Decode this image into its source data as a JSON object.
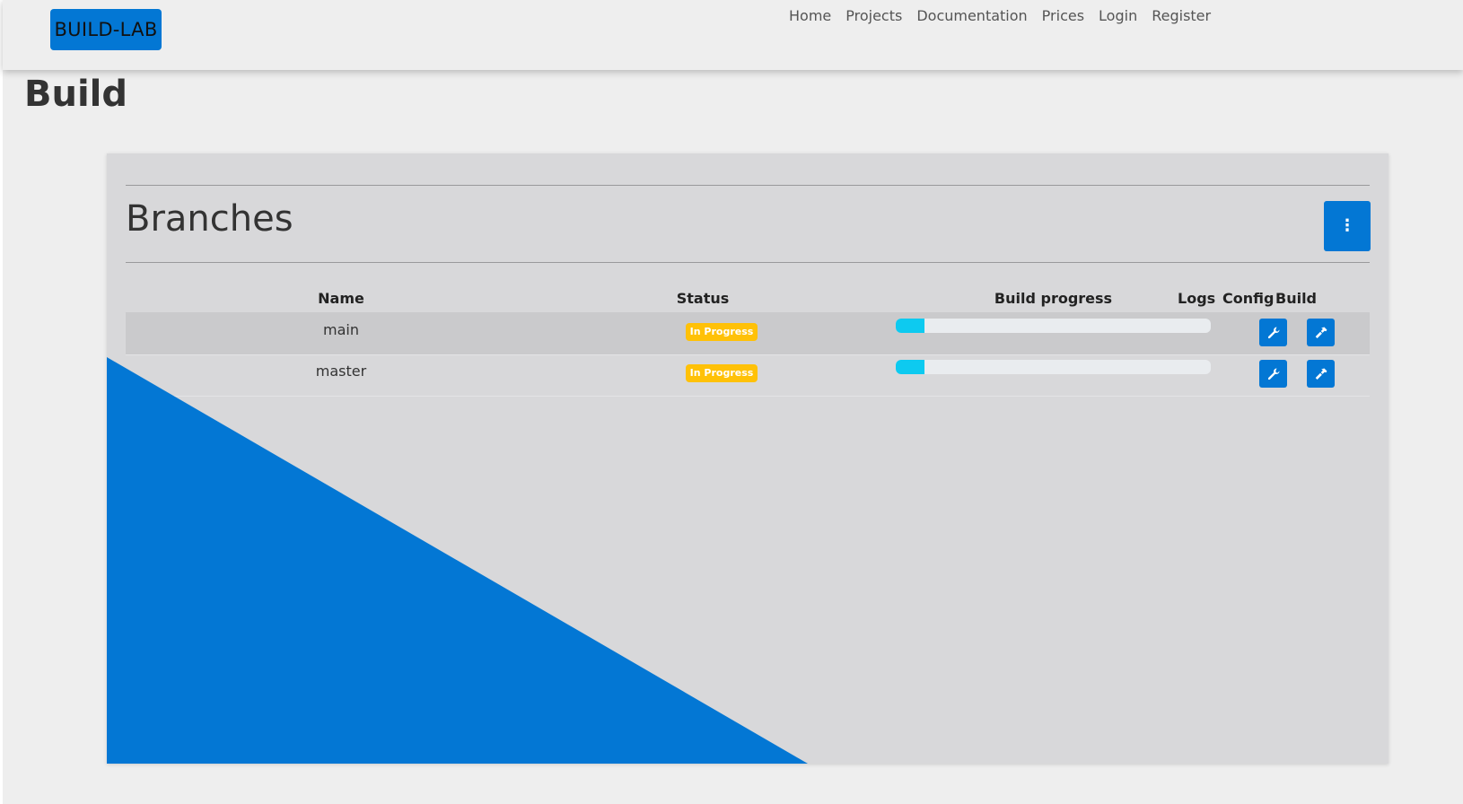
{
  "brand": "BUILD-LAB",
  "nav": [
    "Home",
    "Projects",
    "Documentation",
    "Prices",
    "Login",
    "Register"
  ],
  "page_title": "Build",
  "card": {
    "title": "Branches",
    "menu_icon": "vertical-ellipsis-icon",
    "columns": [
      "Name",
      "Status",
      "Build progress",
      "Logs",
      "Config",
      "Build"
    ],
    "rows": [
      {
        "name": "main",
        "status": "In Progress",
        "progress": 0.09
      },
      {
        "name": "master",
        "status": "In Progress",
        "progress": 0.09
      }
    ]
  },
  "colors": {
    "accent": "#0377d4",
    "badge": "#ffc107",
    "progress_fill": "#0dcaf0",
    "card_background": "#d8d8da"
  },
  "icons": {
    "config": "wrench-icon",
    "build": "hammer-icon"
  }
}
